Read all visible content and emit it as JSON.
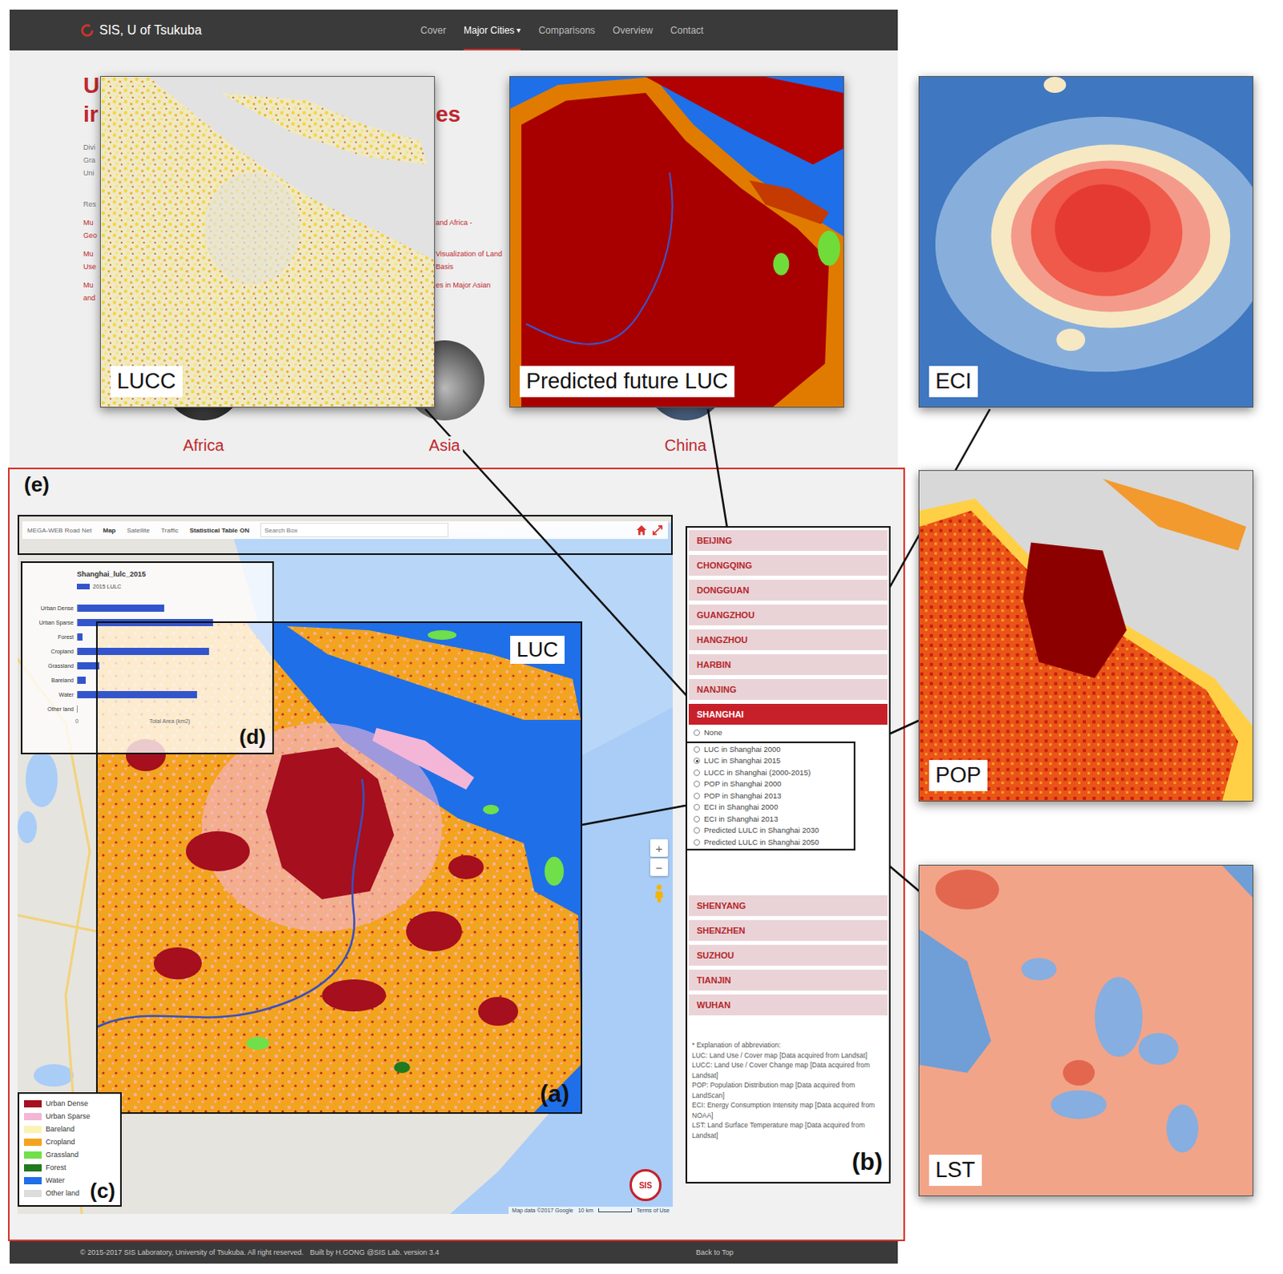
{
  "navbar": {
    "brand": "SIS, U of Tsukuba",
    "items": [
      {
        "label": "Cover",
        "selected": false
      },
      {
        "label": "Major Cities",
        "selected": true,
        "caret": "▾"
      },
      {
        "label": "Comparisons",
        "selected": false
      },
      {
        "label": "Overview",
        "selected": false
      },
      {
        "label": "Contact",
        "selected": false
      }
    ]
  },
  "page": {
    "title": [
      {
        "left": "U"
      },
      {
        "left": "ir",
        "right": "es"
      }
    ],
    "intro": [
      "Divi",
      "Gra",
      "Uni"
    ],
    "research": "Res",
    "links": [
      {
        "left": [
          "Mu",
          "Geo"
        ],
        "right": [
          "and Africa -"
        ]
      },
      {
        "left": [
          "Mu",
          "Use"
        ],
        "right": [
          "Visualization of Land",
          "Basis"
        ]
      },
      {
        "left": [
          "Mu",
          "and"
        ],
        "right": [
          "es in Major Asian"
        ]
      }
    ],
    "regions": [
      {
        "label": "Africa"
      },
      {
        "label": "Asia"
      },
      {
        "label": "China"
      }
    ]
  },
  "overlays": [
    {
      "label": "LUCC",
      "kind": "lucc"
    },
    {
      "label": "Predicted future LUC",
      "kind": "predicted"
    },
    {
      "label": "ECI",
      "kind": "eci"
    },
    {
      "label": "POP",
      "kind": "pop"
    },
    {
      "label": "LST",
      "kind": "lst"
    }
  ],
  "figure_labels": {
    "e": "(e)",
    "a": "(a)",
    "b": "(b)",
    "c": "(c)",
    "d": "(d)"
  },
  "toolbar": {
    "items": [
      {
        "label": "MEGA-WEB Road Net",
        "selected": false
      },
      {
        "label": "Map",
        "selected": true
      },
      {
        "label": "Satellite",
        "selected": false
      },
      {
        "label": "Traffic",
        "selected": false
      },
      {
        "label": "Statistical Table ON",
        "selected": true
      }
    ],
    "search_placeholder": "Search Box"
  },
  "map": {
    "overlay_label": "LUC",
    "zoom_in": "+",
    "zoom_out": "−",
    "attribution": "Map data ©2017 Google",
    "scale": "10 km",
    "terms": "Terms of Use",
    "logo": "SIS"
  },
  "chart": {
    "title": "Shanghai_lulc_2015",
    "series": "2015 LULC",
    "categories": [
      "Urban Dense",
      "Urban Sparse",
      "Forest",
      "Cropland",
      "Grassland",
      "Bareland",
      "Water",
      "Other land"
    ],
    "values": [
      1080,
      1690,
      60,
      1640,
      270,
      100,
      1490,
      0
    ],
    "tick": "0",
    "axis_label": "Total Area (km2)"
  },
  "legend": [
    {
      "label": "Urban Dense",
      "color": "#a50f1e"
    },
    {
      "label": "Urban Sparse",
      "color": "#f4b6d6"
    },
    {
      "label": "Bareland",
      "color": "#fbf3b5"
    },
    {
      "label": "Cropland",
      "color": "#f5a31f"
    },
    {
      "label": "Grassland",
      "color": "#6fe04a"
    },
    {
      "label": "Forest",
      "color": "#1f7a1f"
    },
    {
      "label": "Water",
      "color": "#1f6fe8"
    },
    {
      "label": "Other land",
      "color": "#dcdcdc"
    }
  ],
  "city_list": {
    "before": [
      {
        "label": "BEIJING",
        "selected": false
      },
      {
        "label": "CHONGQING",
        "selected": false
      },
      {
        "label": "DONGGUAN",
        "selected": false
      },
      {
        "label": "GUANGZHOU",
        "selected": false
      },
      {
        "label": "HANGZHOU",
        "selected": false
      },
      {
        "label": "HARBIN",
        "selected": false
      },
      {
        "label": "NANJING",
        "selected": false
      },
      {
        "label": "SHANGHAI",
        "selected": true
      }
    ],
    "layers": [
      {
        "label": "None",
        "selected": false
      },
      {
        "label": "LUC in Shanghai 2000",
        "selected": false
      },
      {
        "label": "LUC in Shanghai 2015",
        "selected": true
      },
      {
        "label": "LUCC in Shanghai (2000-2015)",
        "selected": false
      },
      {
        "label": "POP in Shanghai 2000",
        "selected": false
      },
      {
        "label": "POP in Shanghai 2013",
        "selected": false
      },
      {
        "label": "ECI in Shanghai 2000",
        "selected": false
      },
      {
        "label": "ECI in Shanghai 2013",
        "selected": false
      },
      {
        "label": "Predicted LULC in Shanghai 2030",
        "selected": false
      },
      {
        "label": "Predicted LULC in Shanghai 2050",
        "selected": false
      }
    ],
    "after": [
      {
        "label": "SHENYANG",
        "selected": false
      },
      {
        "label": "SHENZHEN",
        "selected": false
      },
      {
        "label": "SUZHOU",
        "selected": false
      },
      {
        "label": "TIANJIN",
        "selected": false
      },
      {
        "label": "WUHAN",
        "selected": false
      }
    ]
  },
  "notes": {
    "heading": "* Explanation of abbreviation:",
    "items": [
      "LUC: Land Use / Cover map [Data acquired from Landsat]",
      "LUCC: Land Use / Cover Change map [Data acquired from Landsat]",
      "POP: Population Distribution map [Data acquired from LandScan]",
      "ECI: Energy Consumption Intensity map [Data acquired from NOAA]",
      "LST: Land Surface Temperature map [Data acquired from Landsat]"
    ]
  },
  "footer": {
    "copyright": "© 2015-2017 SIS Laboratory, University of Tsukuba. All right reserved.",
    "credit": "Built by H.GONG @SIS Lab. version 3.4",
    "back": "Back to Top"
  }
}
